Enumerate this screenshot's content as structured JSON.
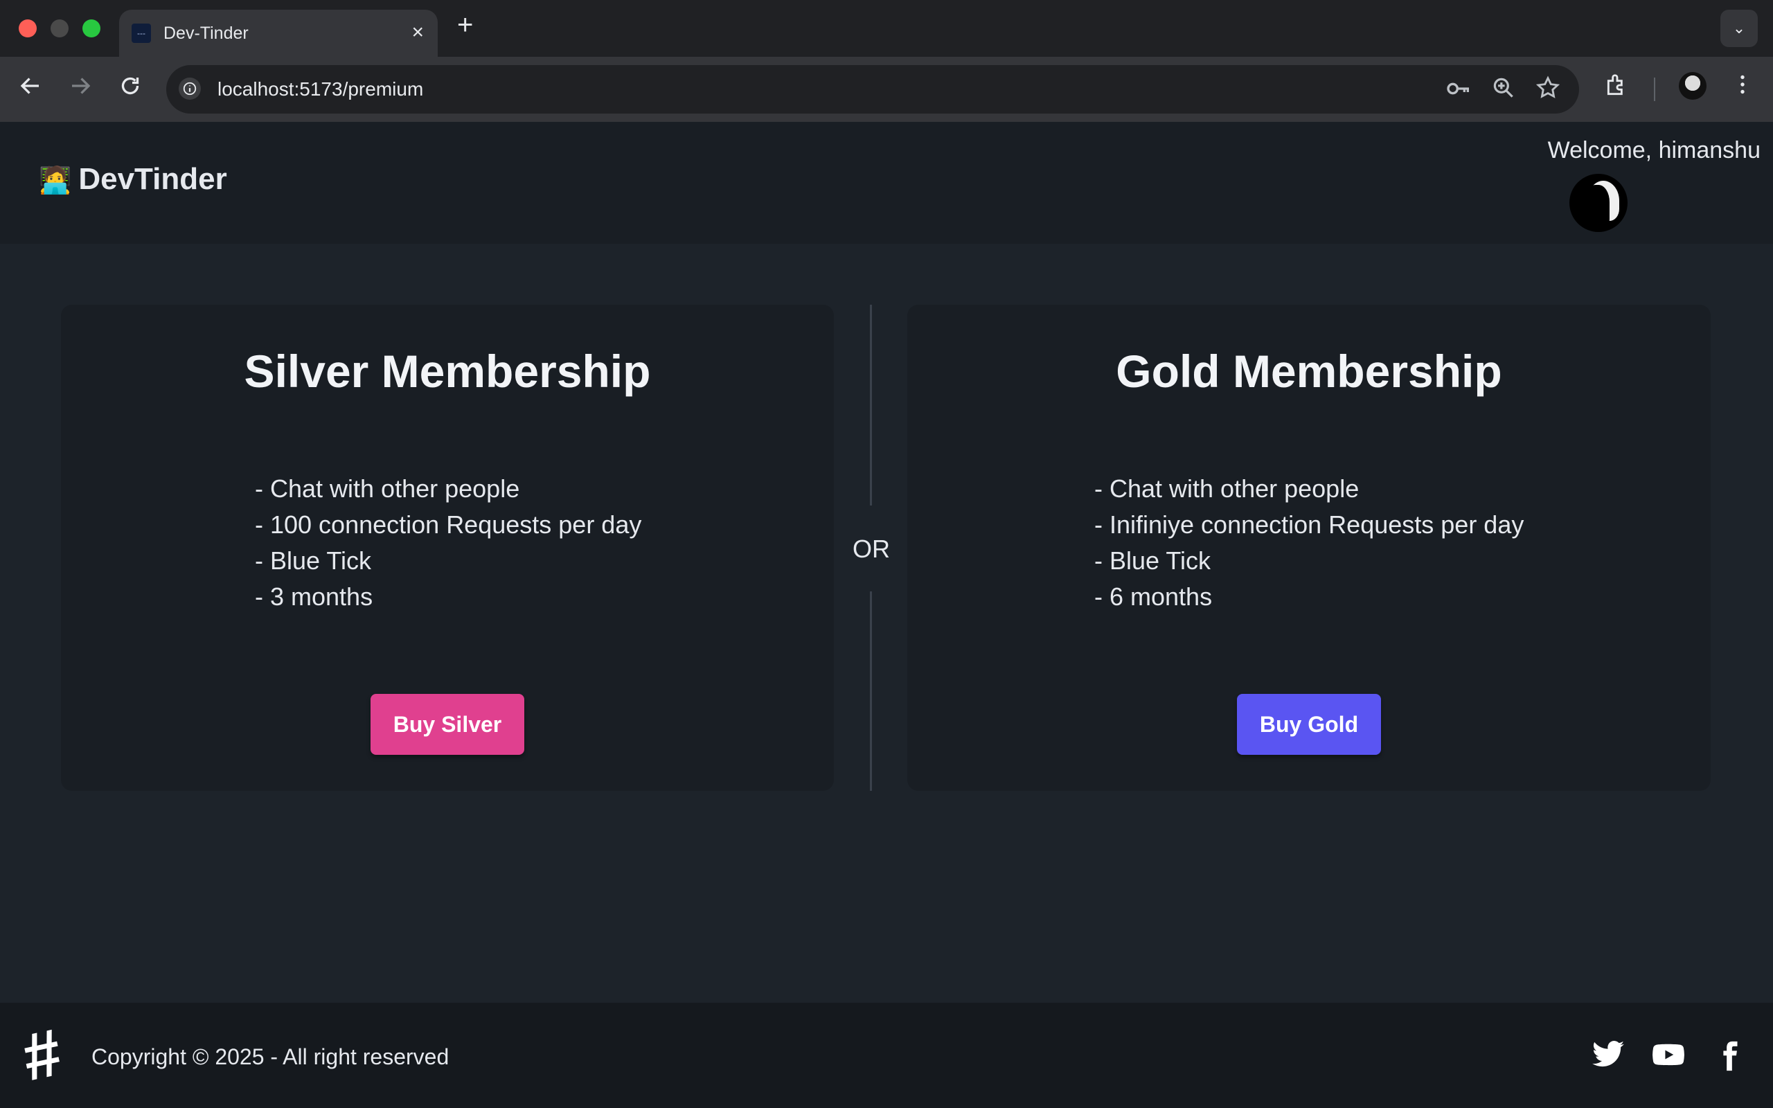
{
  "browser": {
    "tab_title": "Dev-Tinder",
    "favicon_text": "---",
    "close_glyph": "×",
    "new_tab_glyph": "+",
    "tab_menu_glyph": "⌄",
    "url": "localhost:5173/premium",
    "nav_icons": [
      "back-arrow-icon",
      "forward-arrow-icon",
      "reload-icon"
    ],
    "omnibox_icons": [
      "key-icon",
      "zoom-icon",
      "star-icon"
    ],
    "toolbar_icons": [
      "extensions-icon",
      "profile-avatar",
      "more-vert-icon"
    ]
  },
  "navbar": {
    "brand_emoji": "🧑‍💻",
    "brand_name": "DevTinder",
    "welcome": "Welcome, himanshu"
  },
  "plans": [
    {
      "title": "Silver Membership",
      "features": [
        "- Chat with other people",
        "- 100 connection Requests per day",
        "- Blue Tick",
        "- 3 months"
      ],
      "button_label": "Buy Silver",
      "button_color": "#e0408f"
    },
    {
      "title": "Gold Membership",
      "features": [
        "- Chat with other people",
        "- Inifiniye connection Requests per day",
        "- Blue Tick",
        "- 6 months"
      ],
      "button_label": "Buy Gold",
      "button_color": "#5a55f2"
    }
  ],
  "divider_text": "OR",
  "footer": {
    "logo_glyph": "#",
    "copyright": "Copyright © 2025 - All right reserved",
    "social_icons": [
      "twitter-icon",
      "youtube-icon",
      "facebook-icon"
    ]
  },
  "colors": {
    "page_bg": "#1d232a",
    "card_bg": "#191e24",
    "footer_bg": "#15191e"
  }
}
